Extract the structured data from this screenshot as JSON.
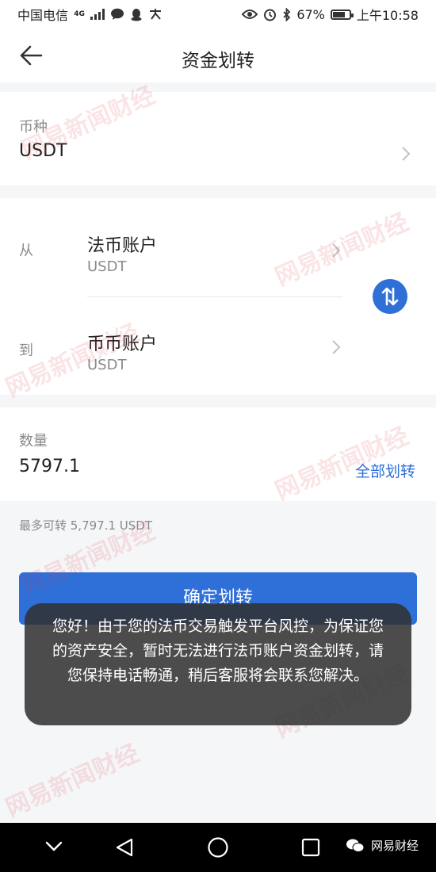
{
  "status_bar": {
    "carrier": "中国电信",
    "network": "4G",
    "battery": "67%",
    "battery_level": 0.67,
    "time": "上午10:58"
  },
  "header": {
    "title": "资金划转"
  },
  "currency": {
    "label": "币种",
    "value": "USDT"
  },
  "transfer": {
    "from_label": "从",
    "from_account": "法币账户",
    "from_currency": "USDT",
    "to_label": "到",
    "to_account": "币币账户",
    "to_currency": "USDT"
  },
  "amount": {
    "label": "数量",
    "value": "5797.1",
    "all_button": "全部划转",
    "max_text": "最多可转 5,797.1 USDT"
  },
  "confirm_button": "确定划转",
  "toast": {
    "message": "您好！由于您的法币交易触发平台风控，为保证您的资产安全，暂时无法进行法币账户资金划转，请您保持电话畅通，稍后客服将会联系您解决。"
  },
  "watermark": {
    "text": "网易新闻财经"
  },
  "footer": {
    "brand": "网易财经"
  },
  "colors": {
    "accent": "#2f6fd8",
    "toast_bg": "#303030",
    "watermark": "#e0373f"
  }
}
